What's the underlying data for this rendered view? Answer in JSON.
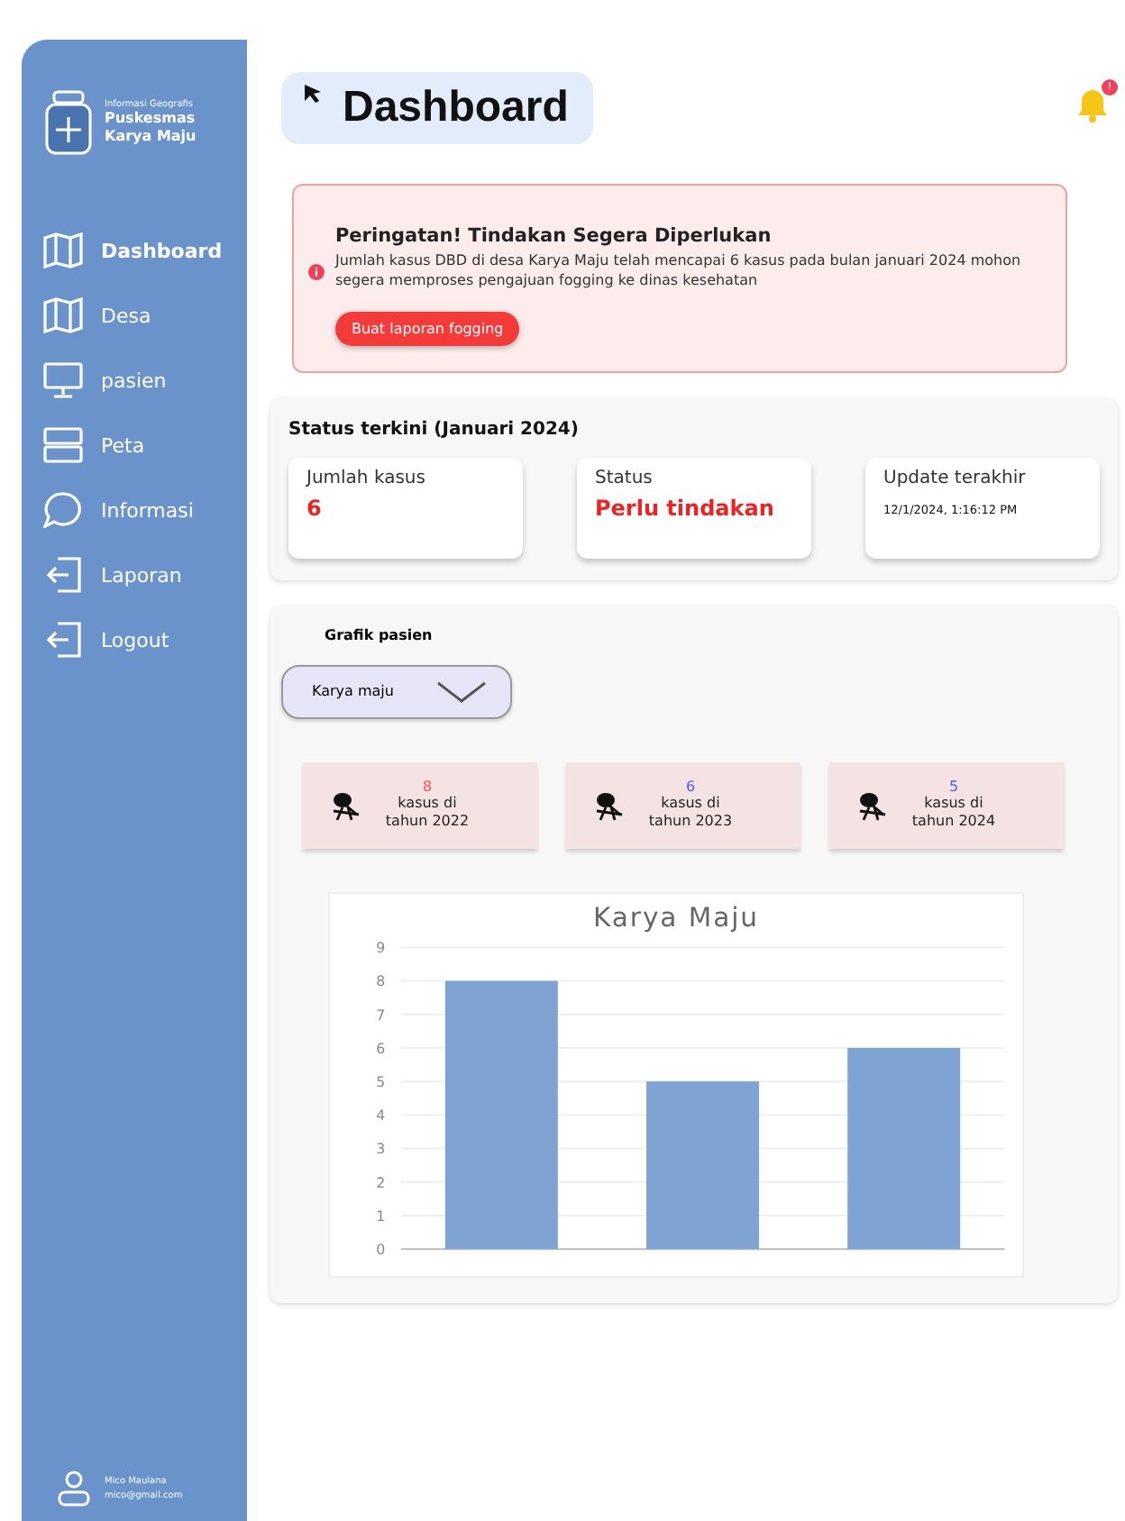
{
  "sidebar": {
    "brand": {
      "subtitle": "Informasi Geografis",
      "title": "Puskesmas Karya Maju"
    },
    "items": [
      {
        "label": "Dashboard",
        "kind": "map",
        "selected": true
      },
      {
        "label": "Desa",
        "kind": "map",
        "selected": false
      },
      {
        "label": "pasien",
        "kind": "monitor",
        "selected": false
      },
      {
        "label": "Peta",
        "kind": "panels",
        "selected": false
      },
      {
        "label": "Informasi",
        "kind": "bubble",
        "selected": false
      },
      {
        "label": "Laporan",
        "kind": "exit",
        "selected": false
      },
      {
        "label": "Logout",
        "kind": "exit",
        "selected": false
      }
    ],
    "user": {
      "name": "Mico Maulana",
      "email": "mico@gmail.com"
    }
  },
  "header": {
    "title": "Dashboard",
    "notification_count": "!"
  },
  "alert": {
    "title": "Peringatan! Tindakan Segera Diperlukan",
    "message": "Jumlah kasus DBD di desa Karya Maju telah mencapai 6 kasus pada bulan januari 2024 mohon segera memproses pengajuan fogging ke dinas kesehatan",
    "button": "Buat laporan fogging"
  },
  "status": {
    "title": "Status terkini (Januari 2024)",
    "cards": [
      {
        "label": "Jumlah kasus",
        "value": "6",
        "kind": "alert"
      },
      {
        "label": "Status",
        "value": "Perlu tindakan",
        "kind": "alert"
      },
      {
        "label": "Update terakhir",
        "value": "12/1/2024, 1:16:12 PM",
        "kind": "plain"
      }
    ]
  },
  "graph": {
    "title": "Grafik pasien",
    "dropdown": "Karya maju",
    "years": [
      {
        "count": "8",
        "text": "kasus di tahun 2022",
        "color": "#ff4b4b"
      },
      {
        "count": "6",
        "text": "kasus di tahun 2023",
        "color": "#4b5bff"
      },
      {
        "count": "5",
        "text": "kasus di tahun 2024",
        "color": "#4b5bff"
      }
    ],
    "chart_data": {
      "type": "bar",
      "title": "Karya Maju",
      "values": [
        8,
        5,
        6
      ],
      "ylim": [
        0,
        9
      ],
      "grid": true,
      "yticks": [
        0,
        1,
        2,
        3,
        4,
        5,
        6,
        7,
        8,
        9
      ]
    }
  }
}
